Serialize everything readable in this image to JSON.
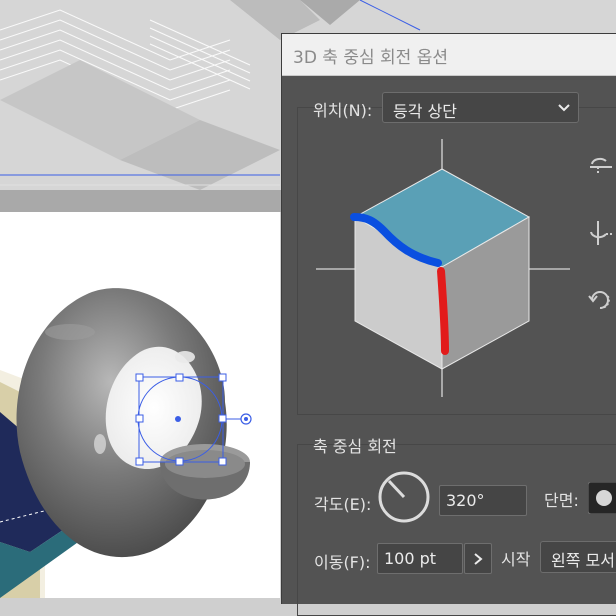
{
  "dialog": {
    "title": "3D 축 중심 회전 옵션",
    "position_label": "위치(N):",
    "position_value": "등각 상단",
    "rotate_section_title": "축 중심 회전",
    "angle_label": "각도(E):",
    "angle_value": "320°",
    "cap_label": "단면:",
    "offset_label": "이동(F):",
    "offset_value": "100 pt",
    "from_label": "시작",
    "from_value": "왼쪽 모서"
  },
  "icons": {
    "rotate_x": "rotate-x-axis-icon",
    "rotate_y": "rotate-y-axis-icon",
    "rotate_z": "rotate-z-axis-icon",
    "angle_dial": "angle-dial-icon",
    "cap_toggle": "cap-solid-toggle-icon",
    "offset_menu": "chevron-right-icon",
    "dropdown": "chevron-down-icon"
  },
  "colors": {
    "cube_top": "#5aa0b6",
    "cube_left": "#cccccc",
    "cube_right": "#9a9a9a",
    "axis_blue": "#0a4fe0",
    "axis_red": "#e21b1b",
    "selection": "#3b5ee6"
  }
}
